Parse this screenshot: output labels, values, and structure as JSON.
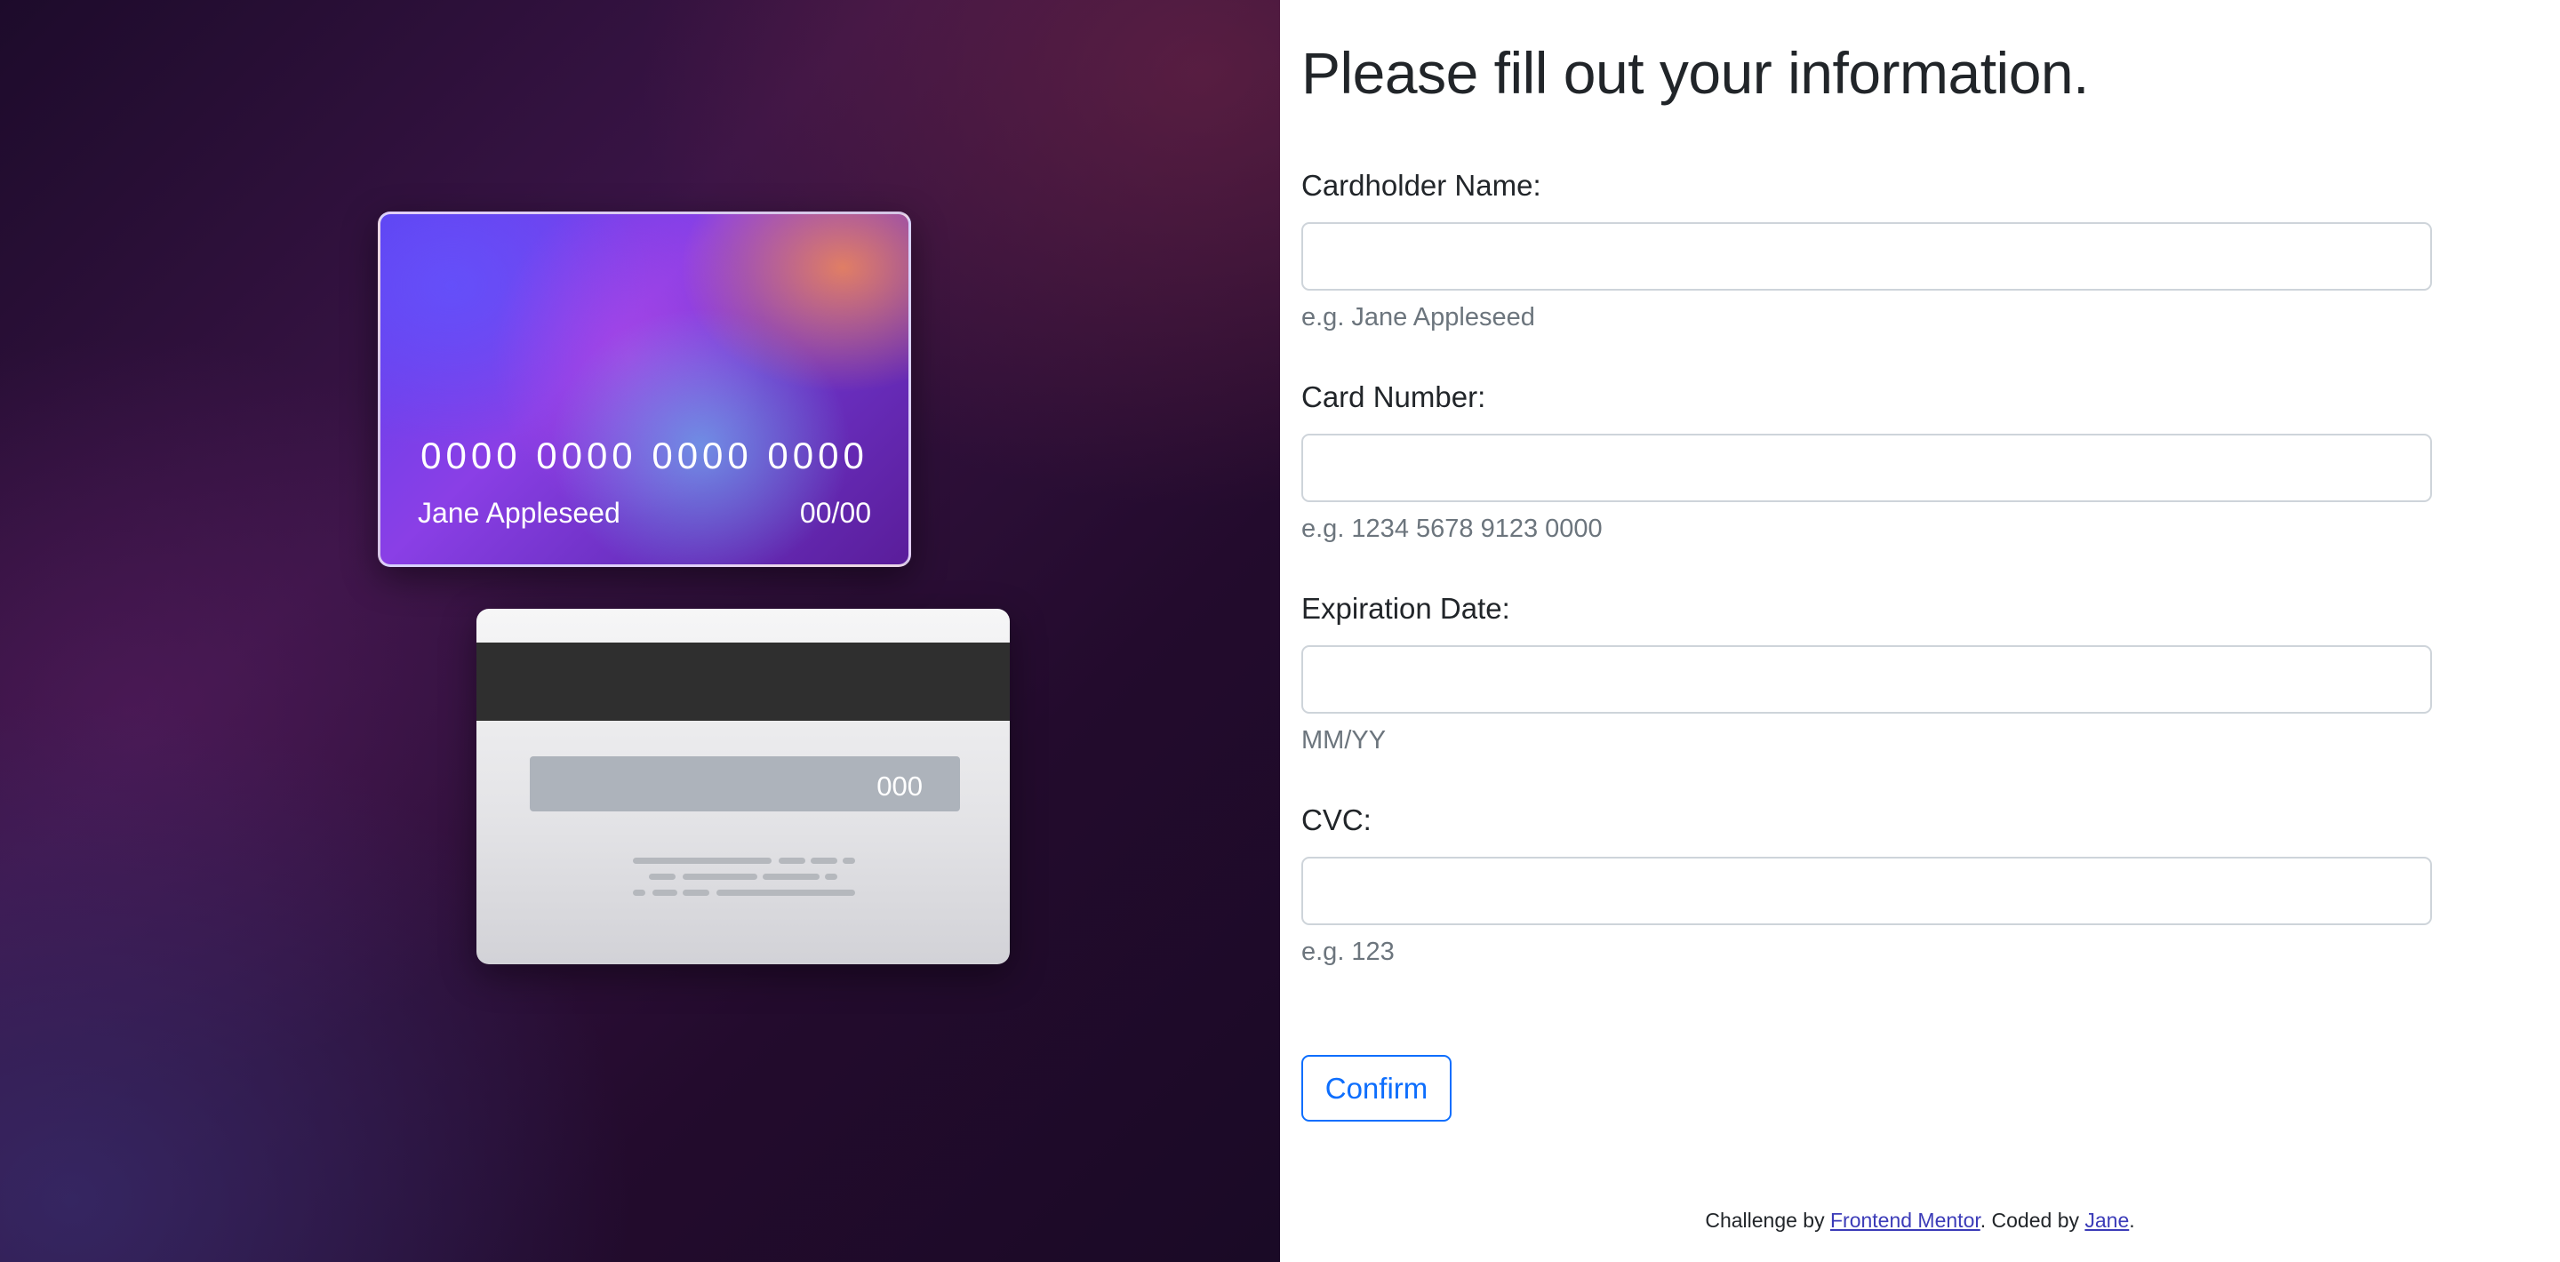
{
  "card_front": {
    "number": "0000 0000 0000 0000",
    "name": "Jane Appleseed",
    "expiry": "00/00"
  },
  "card_back": {
    "cvc": "000"
  },
  "form": {
    "title": "Please fill out your information.",
    "fields": [
      {
        "label": "Cardholder Name:",
        "value": "",
        "hint": "e.g. Jane Appleseed"
      },
      {
        "label": "Card Number:",
        "value": "",
        "hint": "e.g. 1234 5678 9123 0000"
      },
      {
        "label": "Expiration Date:",
        "value": "",
        "hint": "MM/YY"
      },
      {
        "label": "CVC:",
        "value": "",
        "hint": "e.g. 123"
      }
    ],
    "confirm_label": "Confirm"
  },
  "footer": {
    "prefix": "Challenge by ",
    "link1": "Frontend Mentor",
    "middle": ". Coded by ",
    "link2": "Jane",
    "suffix": "."
  },
  "colors": {
    "accent": "#0d6efd",
    "text": "#212529",
    "muted": "#6c757d",
    "input_border": "#ced4da"
  }
}
